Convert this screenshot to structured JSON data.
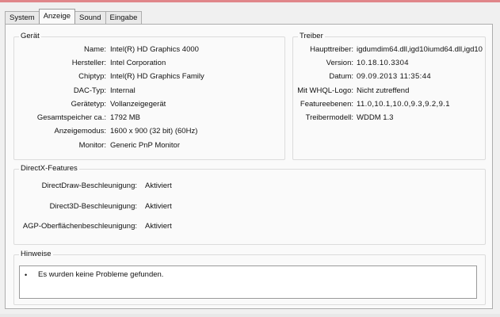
{
  "tabs": [
    "System",
    "Anzeige",
    "Sound",
    "Eingabe"
  ],
  "active_tab": "Anzeige",
  "device": {
    "title": "Gerät",
    "fields": [
      {
        "label": "Name:",
        "value": "Intel(R) HD Graphics 4000"
      },
      {
        "label": "Hersteller:",
        "value": "Intel Corporation"
      },
      {
        "label": "Chiptyp:",
        "value": "Intel(R) HD Graphics Family"
      },
      {
        "label": "DAC-Typ:",
        "value": "Internal"
      },
      {
        "label": "Gerätetyp:",
        "value": "Vollanzeigegerät"
      },
      {
        "label": "Gesamtspeicher ca.:",
        "value": "1792 MB"
      },
      {
        "label": "Anzeigemodus:",
        "value": "1600 x 900 (32 bit) (60Hz)"
      },
      {
        "label": "Monitor:",
        "value": "Generic PnP Monitor"
      }
    ]
  },
  "driver": {
    "title": "Treiber",
    "fields": [
      {
        "label": "Haupttreiber:",
        "value": "igdumdim64.dll,igd10iumd64.dll,igd10"
      },
      {
        "label": "Version:",
        "value": "10.18.10.3304"
      },
      {
        "label": "Datum:",
        "value": "09.09.2013 11:35:44"
      },
      {
        "label": "Mit WHQL-Logo:",
        "value": "Nicht zutreffend"
      },
      {
        "label": "Featureebenen:",
        "value": "11.0,10.1,10.0,9.3,9.2,9.1"
      },
      {
        "label": "Treibermodell:",
        "value": "WDDM 1.3"
      }
    ]
  },
  "directx": {
    "title": "DirectX-Features",
    "fields": [
      {
        "label": "DirectDraw-Beschleunigung:",
        "value": "Aktiviert"
      },
      {
        "label": "Direct3D-Beschleunigung:",
        "value": "Aktiviert"
      },
      {
        "label": "AGP-Oberflächenbeschleunigung:",
        "value": "Aktiviert"
      }
    ]
  },
  "notes": {
    "title": "Hinweise",
    "items": [
      "Es wurden keine Probleme gefunden."
    ]
  }
}
